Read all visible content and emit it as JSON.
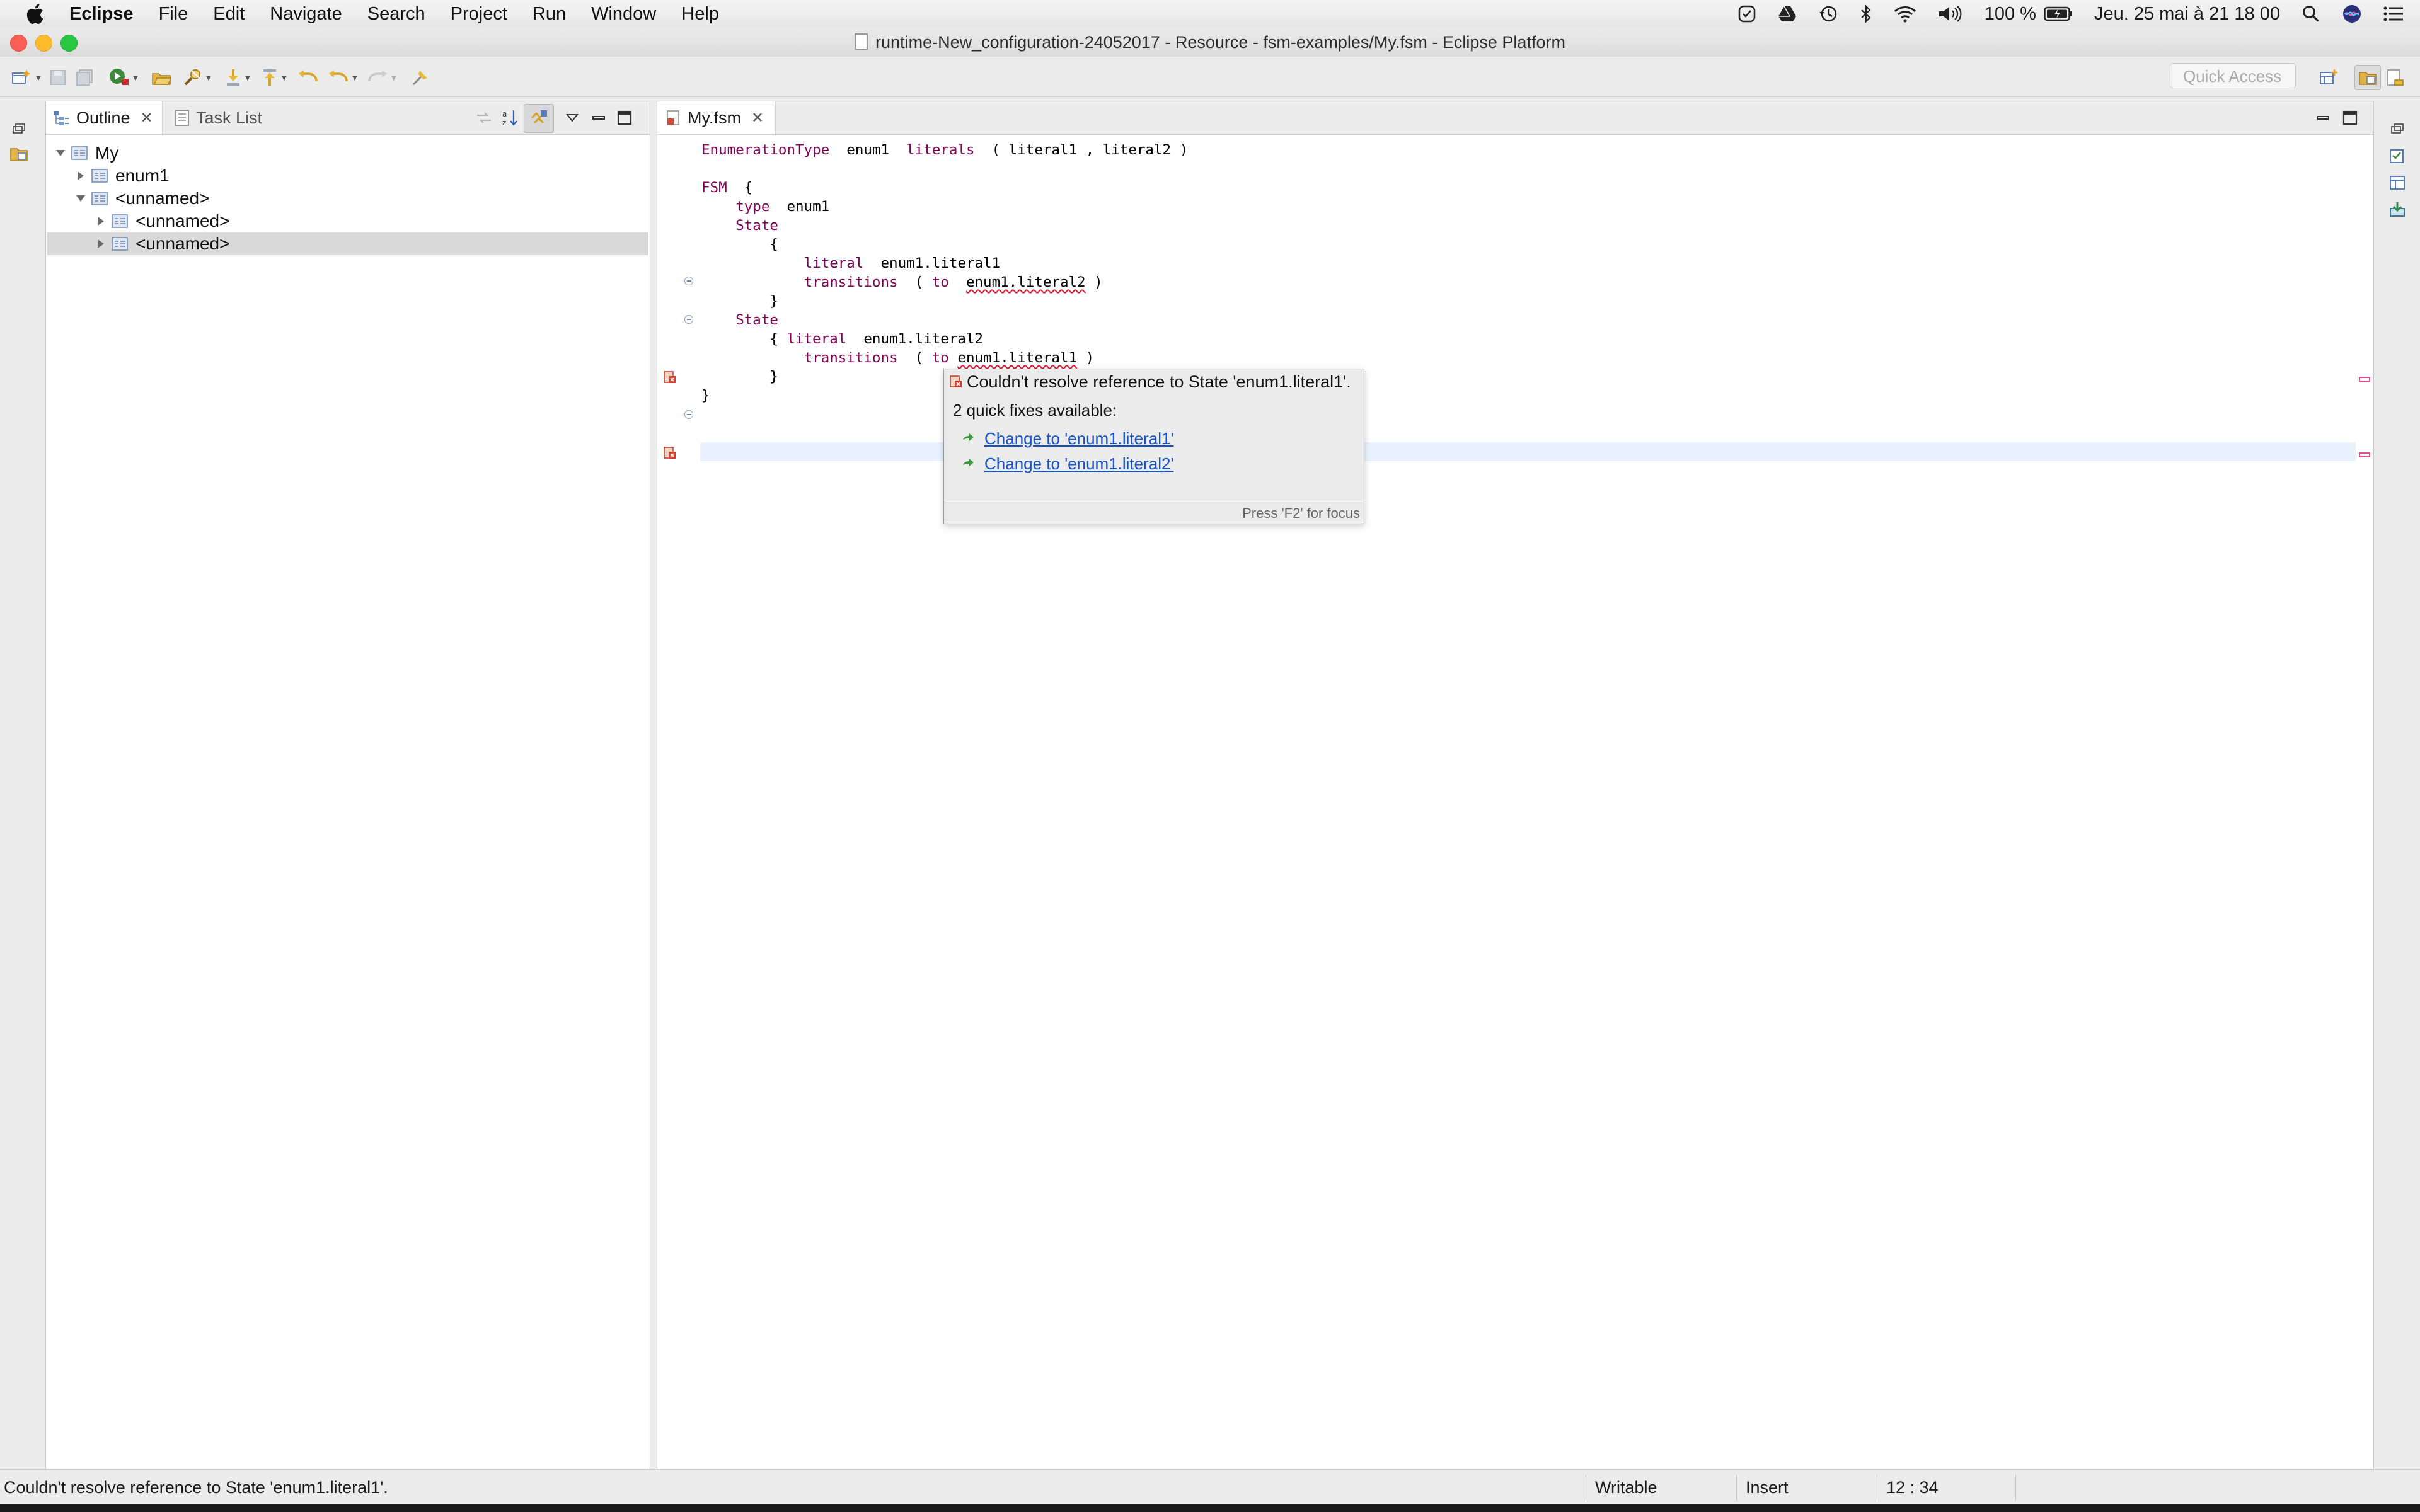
{
  "menubar": {
    "app_name": "Eclipse",
    "items": [
      "File",
      "Edit",
      "Navigate",
      "Search",
      "Project",
      "Run",
      "Window",
      "Help"
    ],
    "battery": "100 %",
    "clock": "Jeu. 25 mai à  21 18 00"
  },
  "window": {
    "title": "runtime-New_configuration-24052017 - Resource - fsm-examples/My.fsm - Eclipse Platform"
  },
  "toolbar": {
    "quick_access_placeholder": "Quick Access"
  },
  "outline": {
    "tab_label": "Outline",
    "task_list_label": "Task List",
    "tree": [
      {
        "label": "My",
        "expanded": true
      },
      {
        "label": "enum1",
        "expanded": false
      },
      {
        "label": "<unnamed>",
        "expanded": true
      },
      {
        "label": "<unnamed>",
        "expanded": false
      },
      {
        "label": "<unnamed>",
        "expanded": false,
        "selected": true
      }
    ]
  },
  "editor": {
    "tab_label": "My.fsm",
    "lines": [
      {
        "parts": [
          [
            "kw",
            "EnumerationType"
          ],
          [
            "",
            "  enum1  "
          ],
          [
            "kw",
            "literals"
          ],
          [
            "",
            "  ( literal1 , literal2 )"
          ]
        ]
      },
      {
        "parts": []
      },
      {
        "parts": [
          [
            "kw",
            "FSM"
          ],
          [
            "",
            "  {"
          ]
        ]
      },
      {
        "parts": [
          [
            "",
            "    "
          ],
          [
            "kw",
            "type"
          ],
          [
            "",
            "  enum1"
          ]
        ]
      },
      {
        "parts": [
          [
            "",
            "    "
          ],
          [
            "kw",
            "State"
          ]
        ]
      },
      {
        "parts": [
          [
            "",
            "        {"
          ]
        ]
      },
      {
        "parts": [
          [
            "",
            "            "
          ],
          [
            "kw",
            "literal"
          ],
          [
            "",
            "  enum1.literal1"
          ]
        ]
      },
      {
        "parts": [
          [
            "",
            "            "
          ],
          [
            "kw",
            "transitions"
          ],
          [
            "",
            "  ( "
          ],
          [
            "kw",
            "to"
          ],
          [
            "",
            "  "
          ],
          [
            "err",
            "enum1.literal2"
          ],
          [
            "",
            " )"
          ]
        ]
      },
      {
        "parts": [
          [
            "",
            "        }"
          ]
        ]
      },
      {
        "parts": [
          [
            "",
            "    "
          ],
          [
            "kw",
            "State"
          ]
        ]
      },
      {
        "parts": [
          [
            "",
            "        { "
          ],
          [
            "kw",
            "literal"
          ],
          [
            "",
            "  enum1.literal2"
          ]
        ]
      },
      {
        "parts": [
          [
            "",
            "            "
          ],
          [
            "kw",
            "transitions"
          ],
          [
            "",
            "  ( "
          ],
          [
            "kw",
            "to"
          ],
          [
            "",
            " "
          ],
          [
            "err",
            "enum1.literal1"
          ],
          [
            "",
            " )"
          ]
        ]
      },
      {
        "parts": [
          [
            "",
            "        }"
          ]
        ]
      },
      {
        "parts": [
          [
            "",
            "}"
          ]
        ]
      }
    ]
  },
  "hover": {
    "error_text": "Couldn't resolve reference to State 'enum1.literal1'.",
    "fix_count_text": "2 quick fixes available:",
    "fixes": [
      "Change to 'enum1.literal1'",
      "Change to 'enum1.literal2'"
    ],
    "footer": "Press 'F2' for focus"
  },
  "statusbar": {
    "message": "Couldn't resolve reference to State 'enum1.literal1'.",
    "writable": "Writable",
    "insert_mode": "Insert",
    "cursor_position": "12 : 34"
  }
}
